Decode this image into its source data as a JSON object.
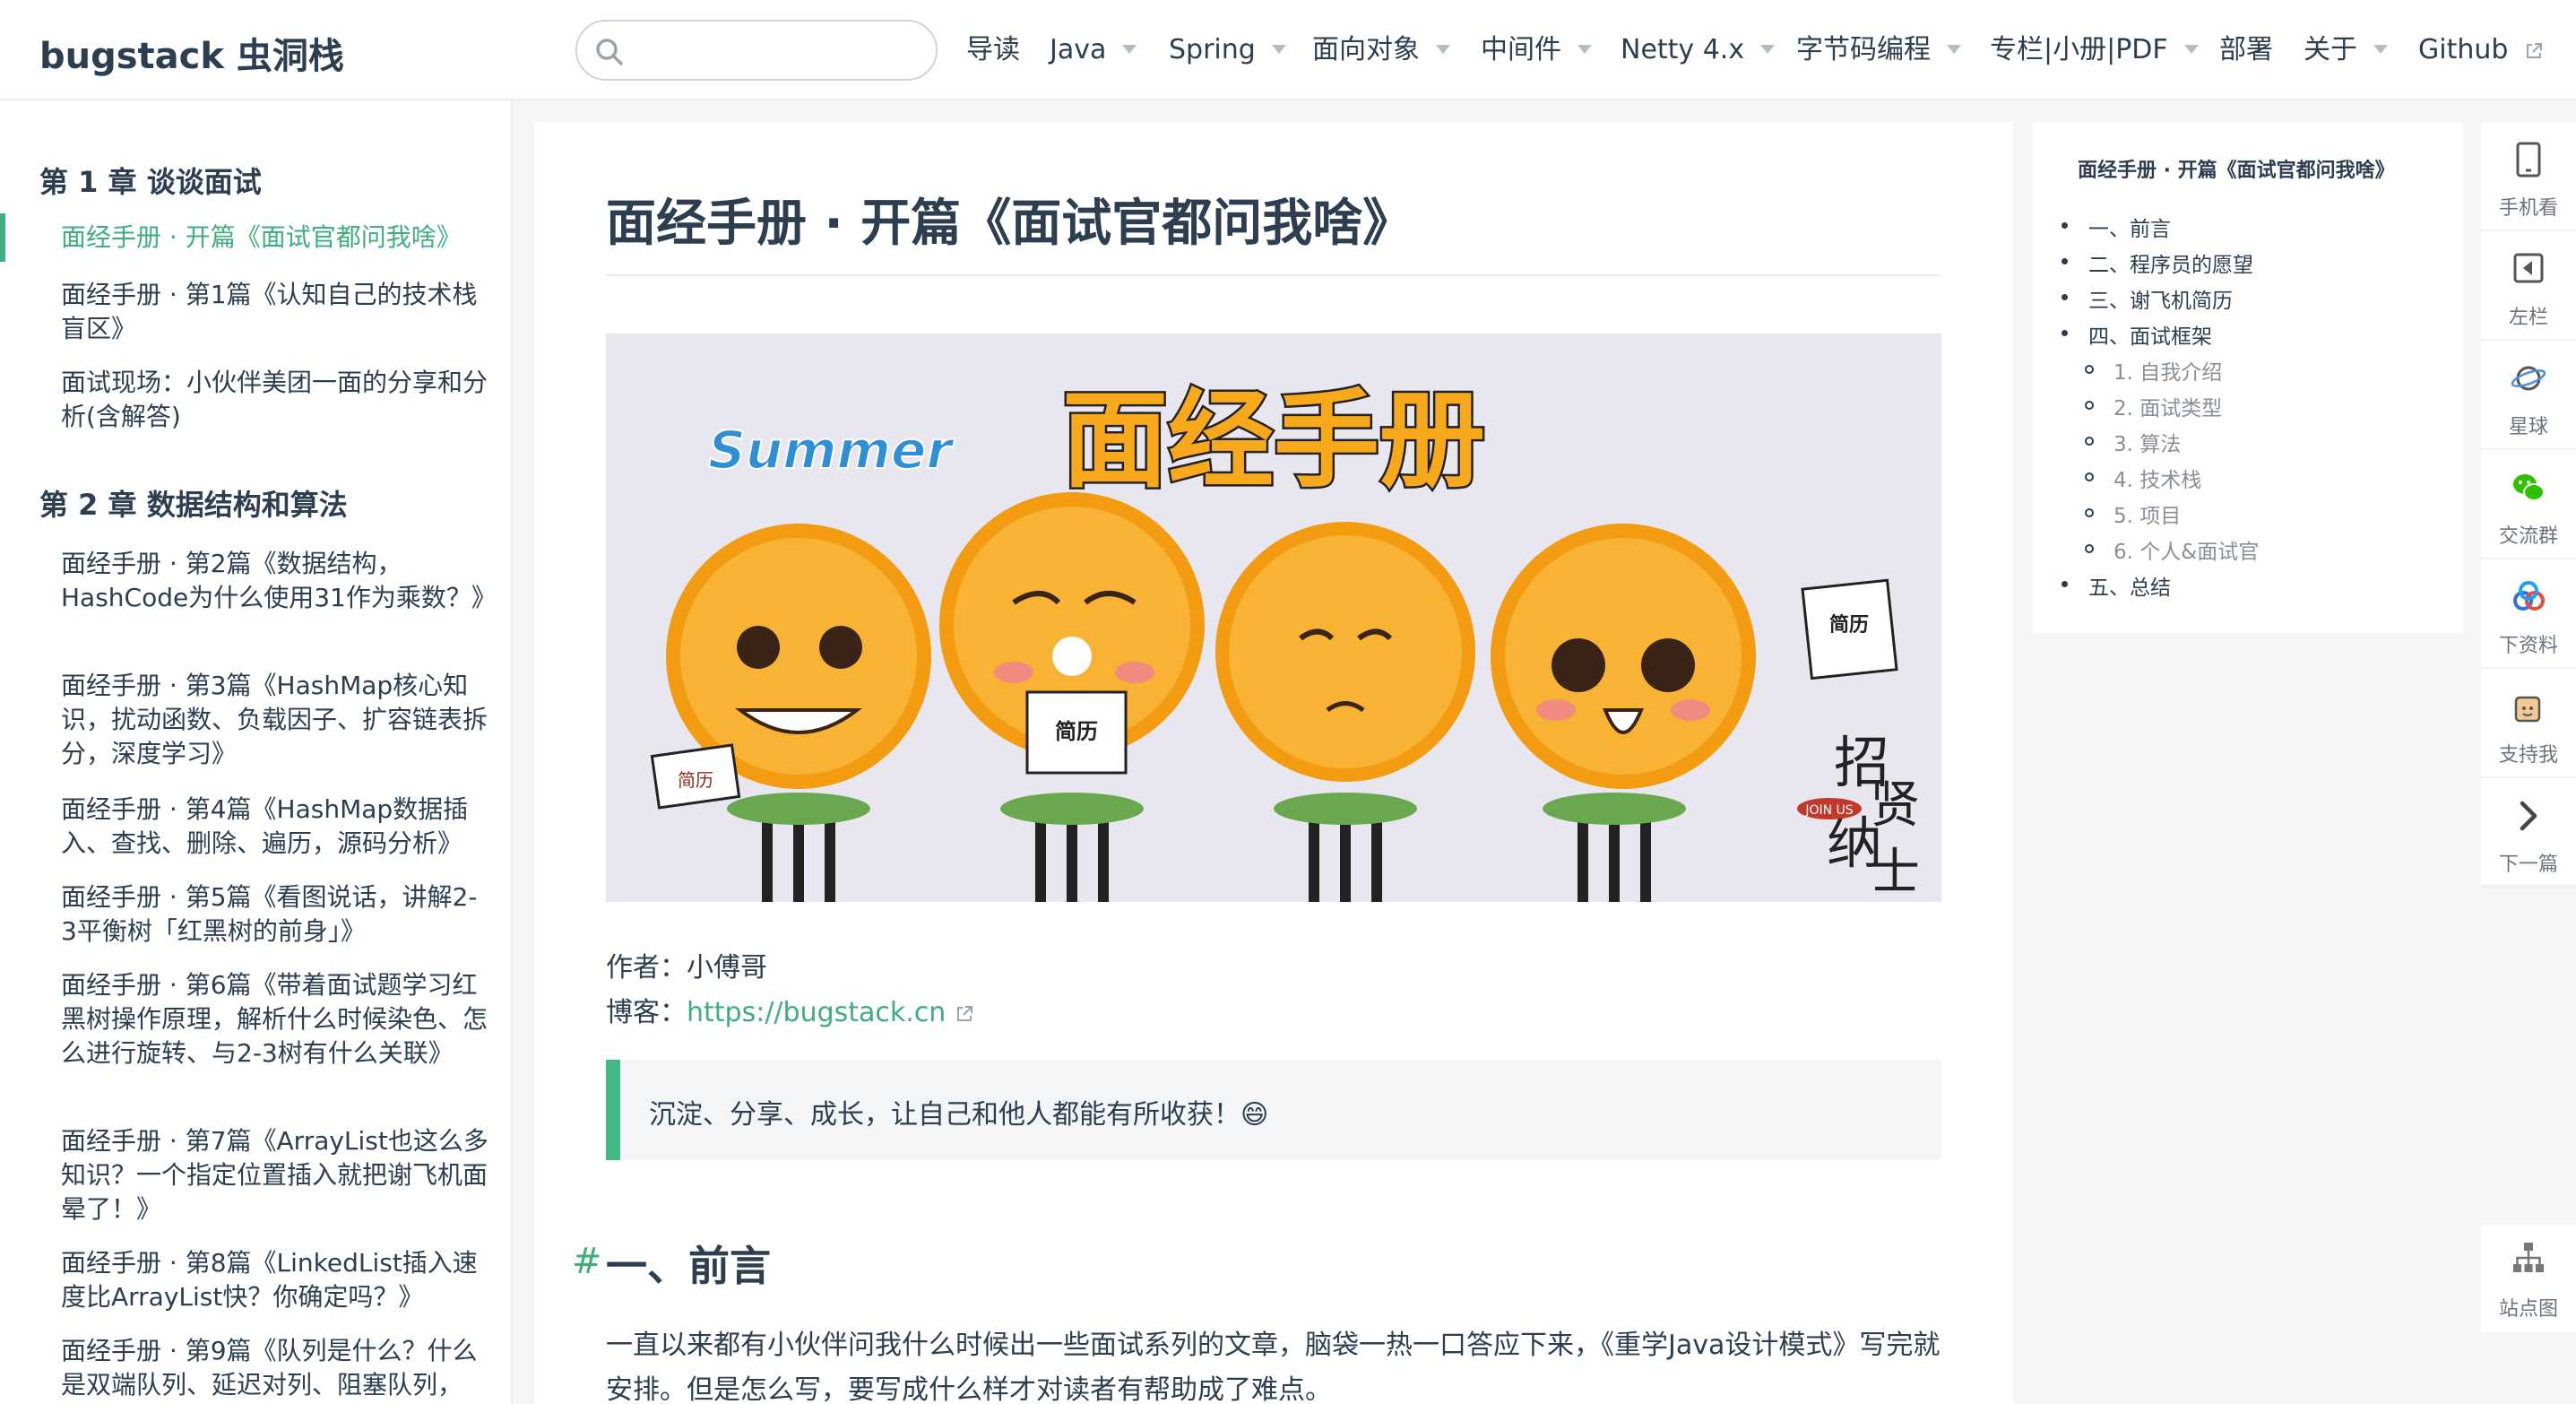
{
  "navbar": {
    "site_name": "bugstack 虫洞栈",
    "search": {
      "placeholder": "",
      "value": ""
    },
    "items": [
      {
        "label": "导读"
      },
      {
        "label": "Java"
      },
      {
        "label": "Spring"
      },
      {
        "label": "面向对象"
      },
      {
        "label": "中间件"
      },
      {
        "label": "Netty 4.x"
      },
      {
        "label": "字节码编程"
      },
      {
        "label": "专栏|小册|PDF"
      },
      {
        "label": "部署"
      },
      {
        "label": "关于"
      },
      {
        "label": "Github"
      }
    ]
  },
  "sidebar": {
    "chapters": [
      {
        "title": "第 1 章 谈谈面试"
      },
      {
        "title": "第 2 章 数据结构和算法"
      }
    ],
    "links": [
      {
        "label": "面经手册 · 开篇《面试官都问我啥》"
      },
      {
        "label": "面经手册 · 第1篇《认知自己的技术栈盲区》"
      },
      {
        "label": "面试现场：小伙伴美团一面的分享和分析(含解答)"
      },
      {
        "label": "面经手册 · 第2篇《数据结构，HashCode为什么使用31作为乘数？》"
      },
      {
        "label": "面经手册 · 第3篇《HashMap核心知识，扰动函数、负载因子、扩容链表拆分，深度学习》"
      },
      {
        "label": "面经手册 · 第4篇《HashMap数据插入、查找、删除、遍历，源码分析》"
      },
      {
        "label": "面经手册 · 第5篇《看图说话，讲解2-3平衡树「红黑树的前身」》"
      },
      {
        "label": "面经手册 · 第6篇《带着面试题学习红黑树操作原理，解析什么时候染色、怎么进行旋转、与2-3树有什么关联》"
      },
      {
        "label": "面经手册 · 第7篇《ArrayList也这么多知识？一个指定位置插入就把谢飞机面晕了！》"
      },
      {
        "label": "面经手册 · 第8篇《LinkedList插入速度比ArrayList快？你确定吗？》"
      },
      {
        "label": "面经手册 · 第9篇《队列是什么？什么是双端队列、延迟对列、阻塞队列，"
      }
    ]
  },
  "content": {
    "title": "面经手册 · 开篇《面试官都问我啥》",
    "banner": {
      "logo_text": "Summer",
      "heading": "面经手册",
      "sign_left": "简历",
      "sign_mid": "简历",
      "sign_right": "简历",
      "stamp": "JOIN US",
      "slogan_1": "招",
      "slogan_2": "贤",
      "slogan_3": "纳",
      "slogan_4": "士"
    },
    "author_label": "作者：",
    "author": "小傅哥",
    "blog_label": "博客：",
    "blog_url": "https://bugstack.cn",
    "quote": "沉淀、分享、成长，让自己和他人都能有所收获！😄",
    "h2_anchor": "#",
    "h2": "一、前言",
    "paragraph": "一直以来都有小伙伴问我什么时候出一些面试系列的文章，脑袋一热一口答应下来，《重学Java设计模式》写完就安排。但是怎么写，要写成什么样才对读者有帮助成了难点。"
  },
  "toc": {
    "title": "面经手册 · 开篇《面试官都问我啥》",
    "items": [
      {
        "label": "一、前言"
      },
      {
        "label": "二、程序员的愿望"
      },
      {
        "label": "三、谢飞机简历"
      },
      {
        "label": "四、面试框架"
      },
      {
        "label": "五、总结"
      }
    ],
    "subitems": [
      {
        "label": "1. 自我介绍"
      },
      {
        "label": "2. 面试类型"
      },
      {
        "label": "3. 算法"
      },
      {
        "label": "4. 技术栈"
      },
      {
        "label": "5. 项目"
      },
      {
        "label": "6. 个人&面试官"
      }
    ]
  },
  "tools": [
    {
      "label": "手机看",
      "icon": "tablet-icon"
    },
    {
      "label": "左栏",
      "icon": "left-panel-icon"
    },
    {
      "label": "星球",
      "icon": "planet-icon"
    },
    {
      "label": "交流群",
      "icon": "wechat-icon"
    },
    {
      "label": "下资料",
      "icon": "cloud-icon"
    },
    {
      "label": "支持我",
      "icon": "coffee-icon"
    },
    {
      "label": "下一篇",
      "icon": "chevron-right-icon"
    }
  ],
  "sitemap": {
    "label": "站点图",
    "icon": "sitemap-icon"
  },
  "colors": {
    "accent": "#3eaf7c",
    "text": "#2c3e50",
    "quote_border": "#42b983"
  }
}
